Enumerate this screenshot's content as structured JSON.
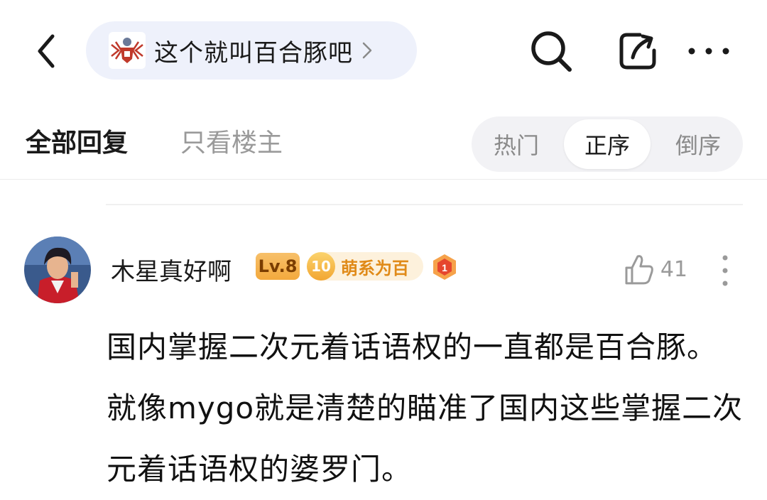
{
  "header": {
    "forum_name": "这个就叫百合豚吧",
    "back_icon": "chevron-left-icon",
    "search_icon": "search-icon",
    "share_icon": "share-icon",
    "more_icon": "more-horizontal-icon"
  },
  "tabs": {
    "all_replies": "全部回复",
    "owner_only": "只看楼主",
    "sort_options": [
      "热门",
      "正序",
      "倒序"
    ],
    "sort_selected": "正序"
  },
  "post": {
    "username": "木星真好啊",
    "level_badge": "Lv.8",
    "fan_level": "10",
    "fan_title": "萌系为百",
    "medal_number": "1",
    "like_count": "41",
    "content": "国内掌握二次元着话语权的一直都是百合豚。就像mygo就是清楚的瞄准了国内这些掌握二次元着话语权的婆罗门。"
  },
  "colors": {
    "accent_pill": "#eef1fb",
    "level_badge": "#f3a93d",
    "fan_badge_text": "#e08a18",
    "muted_text": "#9a9a9a"
  }
}
